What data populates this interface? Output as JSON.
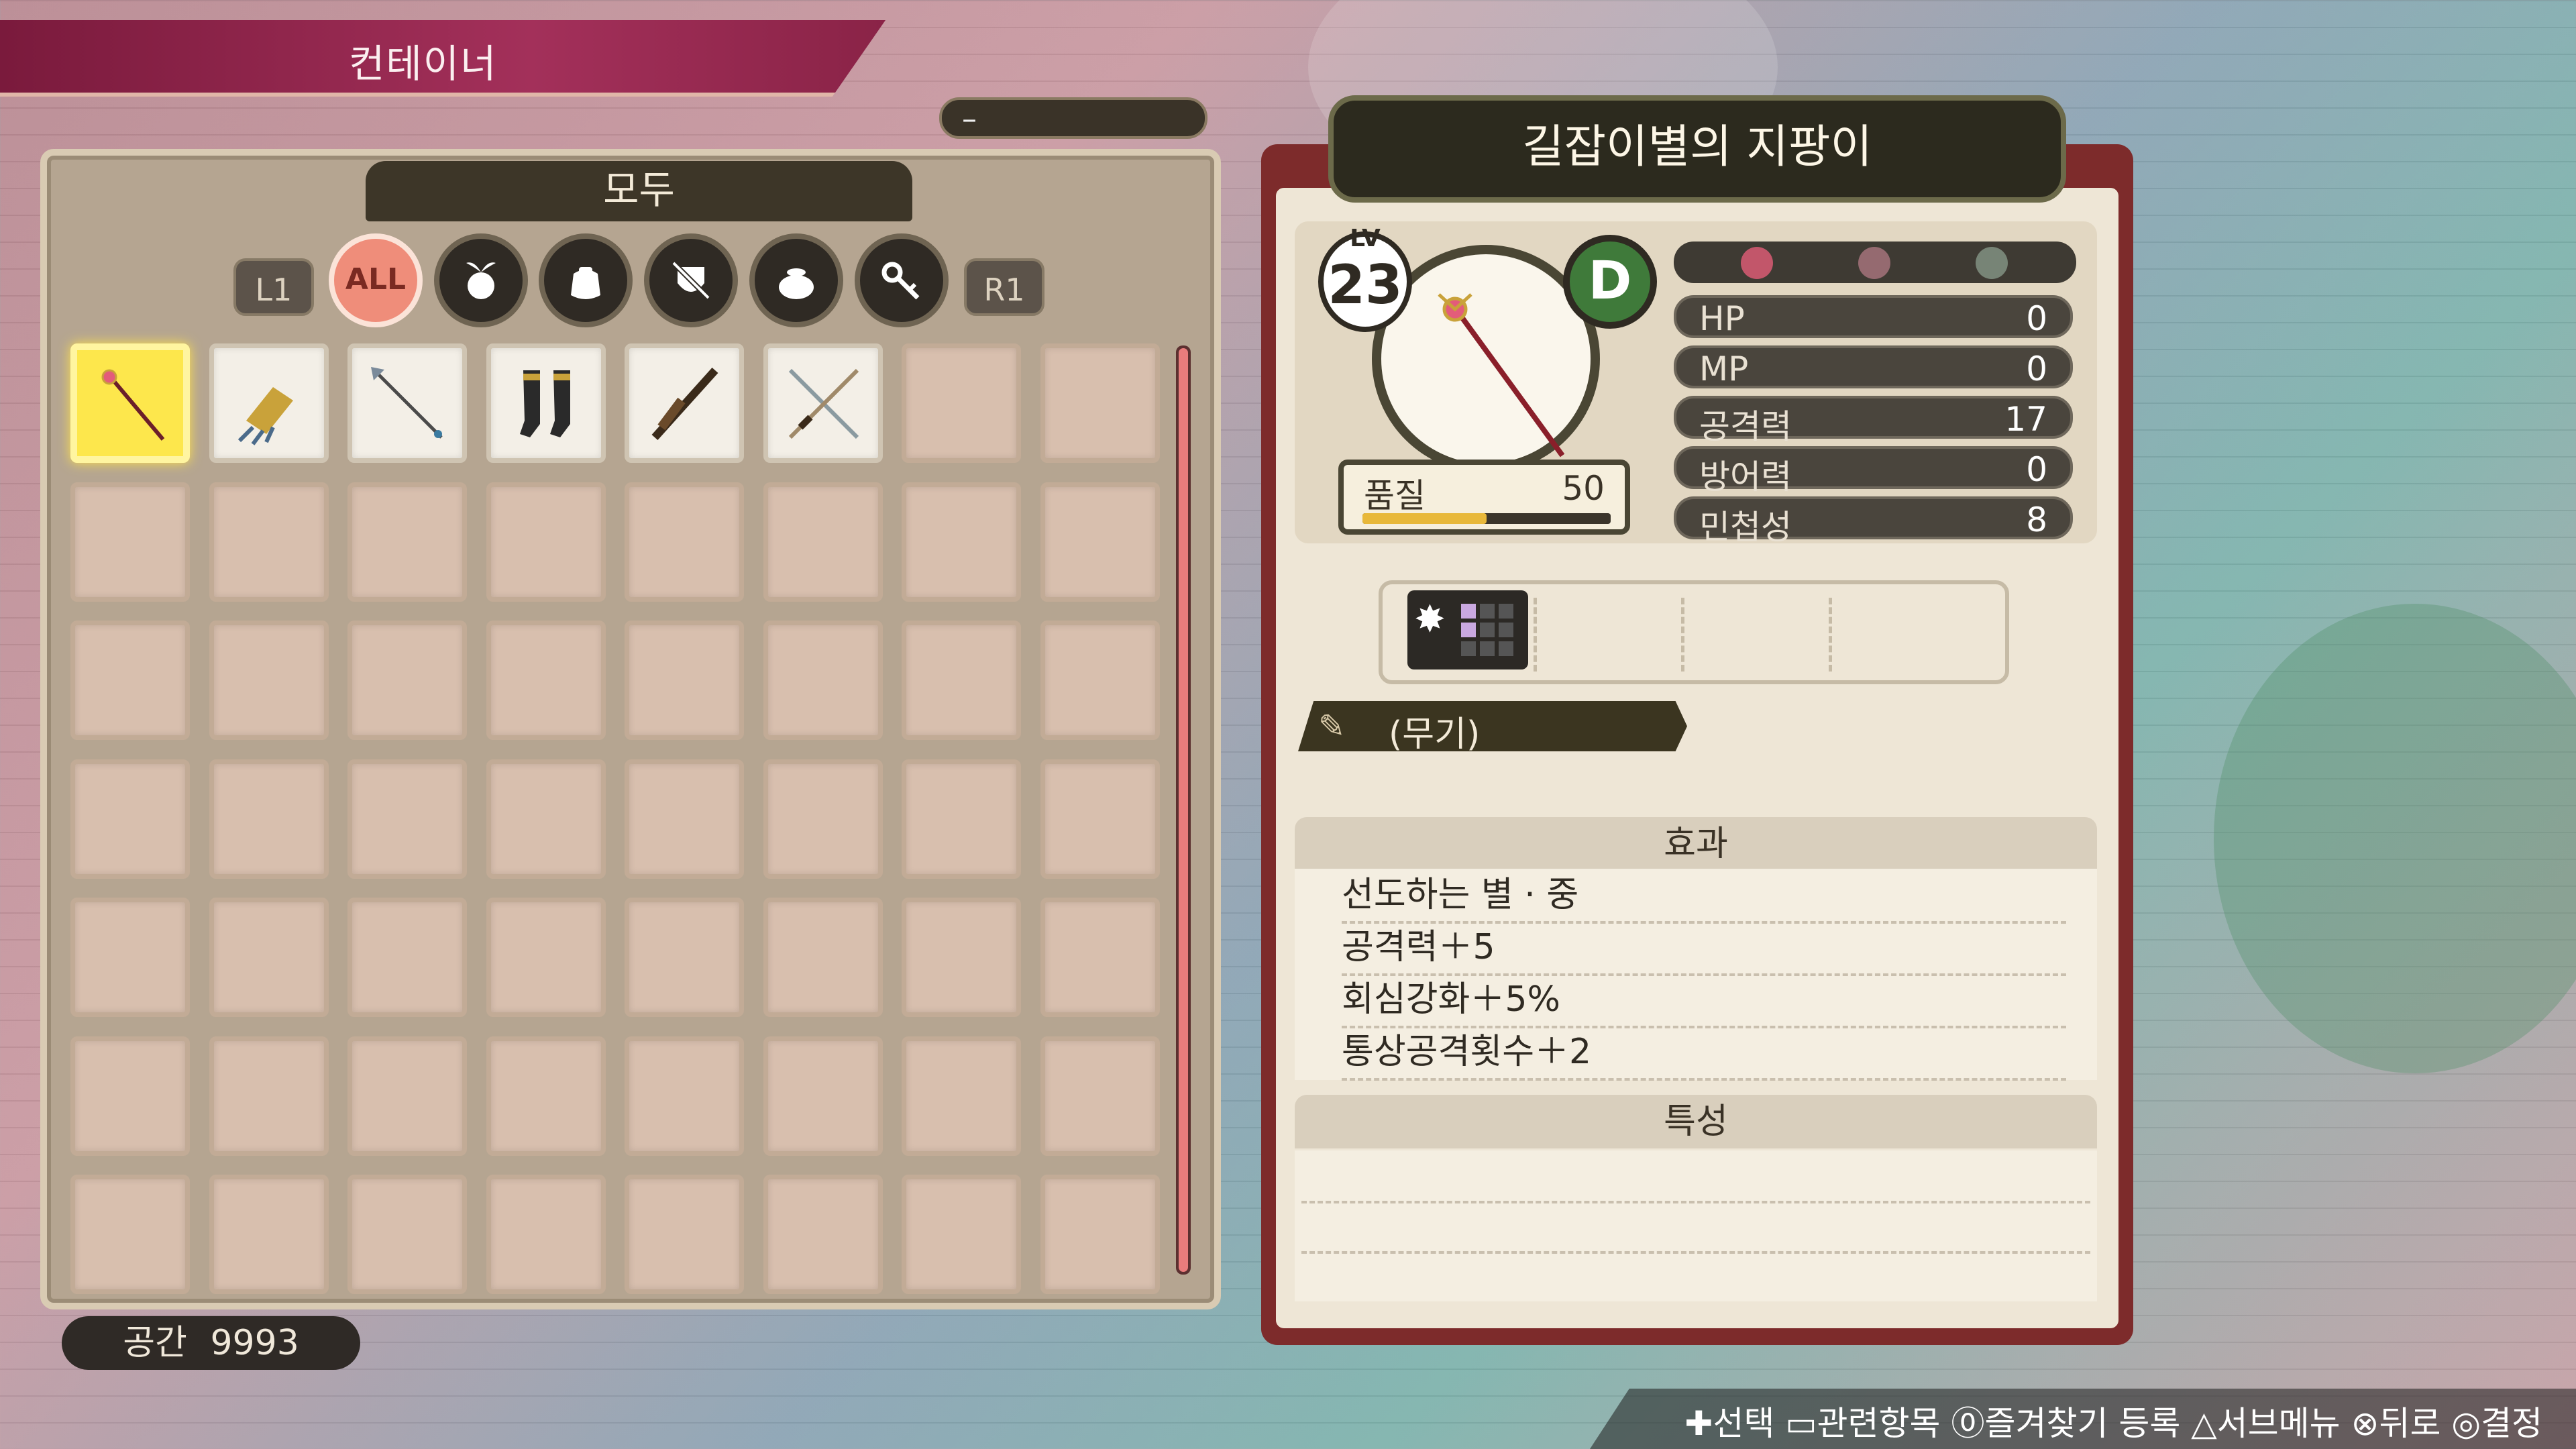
{
  "header": {
    "title": "컨테이너",
    "sort_indicator": "–"
  },
  "category": {
    "current": "모두",
    "nav_left": "L1",
    "nav_right": "R1",
    "buttons": [
      {
        "label": "ALL",
        "icon": "all-icon",
        "active": true
      },
      {
        "icon": "ingredient-icon"
      },
      {
        "icon": "bag-icon"
      },
      {
        "icon": "weapon-armor-icon"
      },
      {
        "icon": "pot-icon"
      },
      {
        "icon": "key-item-icon"
      }
    ]
  },
  "inventory": {
    "columns": 8,
    "rows": 7,
    "items": [
      {
        "name": "길잡이별의 지팡이",
        "icon": "staff-icon",
        "selected": true
      },
      {
        "icon": "gauntlet-icon"
      },
      {
        "icon": "spear-icon"
      },
      {
        "icon": "boots-icon"
      },
      {
        "icon": "rifle-icon"
      },
      {
        "icon": "crossed-swords-icon"
      }
    ]
  },
  "space": {
    "label": "공간",
    "value": "9993"
  },
  "detail": {
    "name": "길잡이별의 지팡이",
    "level_label": "LV",
    "level": "23",
    "grade": "D",
    "quality_label": "품질",
    "quality": "50",
    "quality_fraction": 0.5,
    "stats": [
      {
        "label": "HP",
        "value": "0"
      },
      {
        "label": "MP",
        "value": "0"
      },
      {
        "label": "공격력",
        "value": "17"
      },
      {
        "label": "방어력",
        "value": "0"
      },
      {
        "label": "민첩성",
        "value": "8"
      }
    ],
    "type": "(무기)",
    "effects_header": "효과",
    "effects": [
      "선도하는 별 · 중",
      "공격력＋5",
      "회심강화＋5%",
      "통상공격횟수＋2"
    ],
    "traits_header": "특성"
  },
  "footer": {
    "hint": "✚선택 ▭관련항목 ⓪즐겨찾기 등록 △서브메뉴 ⊗뒤로 ◎결정"
  },
  "colors": {
    "selected_slot": "#fde74c",
    "accent_red": "#7d2b2b",
    "grade_green": "#3f7a3a"
  }
}
